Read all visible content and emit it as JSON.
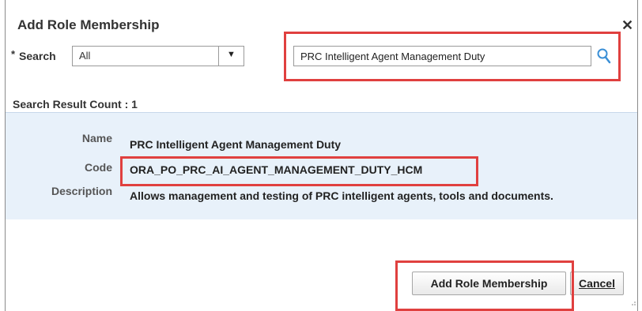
{
  "dialog": {
    "title": "Add Role Membership",
    "close_glyph": "✕"
  },
  "search": {
    "required_marker": "*",
    "label": "Search",
    "select_value": "All",
    "dropdown_glyph": "▼",
    "query": "PRC Intelligent Agent Management Duty"
  },
  "results": {
    "count_text": "Search Result Count : 1",
    "name_label": "Name",
    "name_value": "PRC Intelligent Agent Management Duty",
    "code_label": "Code",
    "code_value": "ORA_PO_PRC_AI_AGENT_MANAGEMENT_DUTY_HCM",
    "description_label": "Description",
    "description_value": "Allows management and testing of PRC intelligent agents, tools and documents."
  },
  "buttons": {
    "add_label": "Add Role Membership",
    "cancel_first": "C",
    "cancel_rest": "ancel"
  },
  "colors": {
    "highlight": "#e0403f",
    "result_panel": "#e8f1fa",
    "search_icon": "#3a8fd6"
  }
}
